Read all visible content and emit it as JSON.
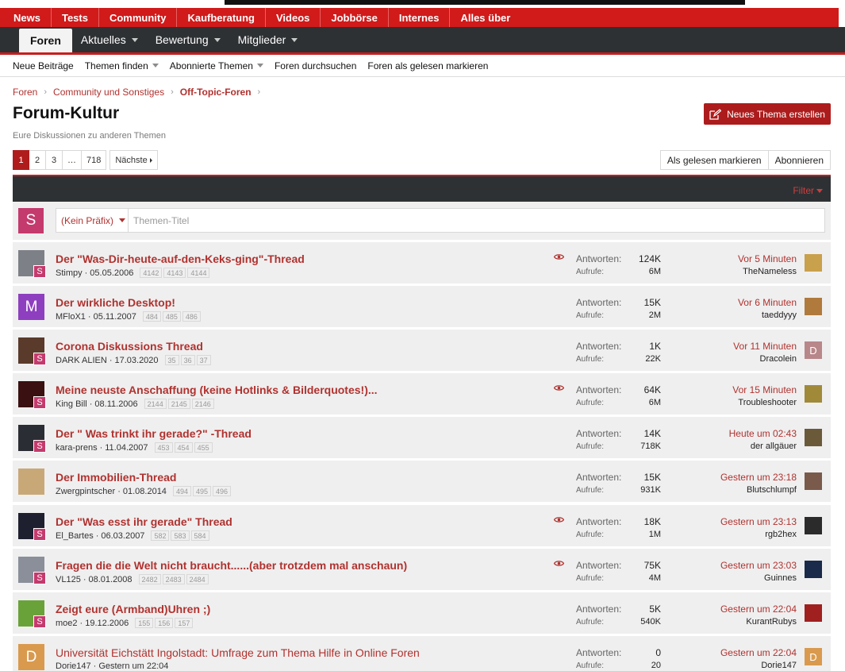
{
  "top_nav": [
    "News",
    "Tests",
    "Community",
    "Kaufberatung",
    "Videos",
    "Jobbörse",
    "Internes",
    "Alles über"
  ],
  "sub_nav": {
    "active": "Foren",
    "items": [
      "Aktuelles",
      "Bewertung",
      "Mitglieder"
    ]
  },
  "third_nav": [
    "Neue Beiträge",
    "Themen finden",
    "Abonnierte Themen",
    "Foren durchsuchen",
    "Foren als gelesen markieren"
  ],
  "breadcrumb": [
    "Foren",
    "Community und Sonstiges",
    "Off-Topic-Foren"
  ],
  "page": {
    "title": "Forum-Kultur",
    "description": "Eure Diskussionen zu anderen Themen",
    "new_thread": "Neues Thema erstellen"
  },
  "pagination": {
    "pages": [
      "1",
      "2",
      "3",
      "…",
      "718"
    ],
    "current": "1",
    "next": "Nächste"
  },
  "actions": {
    "mark_read": "Als gelesen markieren",
    "subscribe": "Abonnieren"
  },
  "filter": "Filter",
  "quick_thread": {
    "avatar_letter": "S",
    "prefix": "(Kein Präfix)",
    "placeholder": "Themen-Titel"
  },
  "stat_labels": {
    "replies": "Antworten:",
    "views": "Aufrufe:"
  },
  "colors": {
    "brand_red": "#d11a1a",
    "dark_bar": "#2e3134",
    "link_red": "#b0322f",
    "row_bg": "#efefef"
  },
  "threads": [
    {
      "title": "Der \"Was-Dir-heute-auf-den-Keks-ging\"-Thread",
      "author": "Stimpy",
      "date": "05.05.2006",
      "pages": [
        "4142",
        "4143",
        "4144"
      ],
      "watched": true,
      "replies": "124K",
      "views": "6M",
      "last_time": "Vor 5 Minuten",
      "last_user": "TheNameless",
      "avatar_letter": "",
      "avatar_color": "#7d8087",
      "badge": "S",
      "last_avatar_letter": "",
      "last_avatar_color": "#c9a04c"
    },
    {
      "title": "Der wirkliche Desktop!",
      "author": "MFloX1",
      "date": "05.11.2007",
      "pages": [
        "484",
        "485",
        "486"
      ],
      "watched": false,
      "replies": "15K",
      "views": "2M",
      "last_time": "Vor 6 Minuten",
      "last_user": "taeddyyy",
      "avatar_letter": "M",
      "avatar_color": "#8e3fbf",
      "badge": "",
      "last_avatar_letter": "",
      "last_avatar_color": "#b07a3c"
    },
    {
      "title": "Corona Diskussions Thread",
      "author": "DARK ALIEN",
      "date": "17.03.2020",
      "pages": [
        "35",
        "36",
        "37"
      ],
      "watched": false,
      "replies": "1K",
      "views": "22K",
      "last_time": "Vor 11 Minuten",
      "last_user": "Dracolein",
      "avatar_letter": "",
      "avatar_color": "#5a3a2a",
      "badge": "S",
      "last_avatar_letter": "D",
      "last_avatar_color": "#b8878a"
    },
    {
      "title": "Meine neuste Anschaffung (keine Hotlinks & Bilderquotes!)...",
      "author": "King Bill",
      "date": "08.11.2006",
      "pages": [
        "2144",
        "2145",
        "2146"
      ],
      "watched": true,
      "replies": "64K",
      "views": "6M",
      "last_time": "Vor 15 Minuten",
      "last_user": "Troubleshooter",
      "avatar_letter": "",
      "avatar_color": "#3a1010",
      "badge": "S",
      "last_avatar_letter": "",
      "last_avatar_color": "#a08a3a"
    },
    {
      "title": "Der \" Was trinkt ihr gerade?\" -Thread",
      "author": "kara-prens",
      "date": "11.04.2007",
      "pages": [
        "453",
        "454",
        "455"
      ],
      "watched": false,
      "replies": "14K",
      "views": "718K",
      "last_time": "Heute um 02:43",
      "last_user": "der allgäuer",
      "avatar_letter": "",
      "avatar_color": "#2a2d33",
      "badge": "S",
      "last_avatar_letter": "",
      "last_avatar_color": "#6b5a3a"
    },
    {
      "title": "Der Immobilien-Thread",
      "author": "Zwergpintscher",
      "date": "01.08.2014",
      "pages": [
        "494",
        "495",
        "496"
      ],
      "watched": false,
      "replies": "15K",
      "views": "931K",
      "last_time": "Gestern um 23:18",
      "last_user": "Blutschlumpf",
      "avatar_letter": "",
      "avatar_color": "#c9a878",
      "badge": "",
      "last_avatar_letter": "",
      "last_avatar_color": "#7a5a4a"
    },
    {
      "title": "Der \"Was esst ihr gerade\" Thread",
      "author": "El_Bartes",
      "date": "06.03.2007",
      "pages": [
        "582",
        "583",
        "584"
      ],
      "watched": true,
      "replies": "18K",
      "views": "1M",
      "last_time": "Gestern um 23:13",
      "last_user": "rgb2hex",
      "avatar_letter": "",
      "avatar_color": "#1e2030",
      "badge": "S",
      "last_avatar_letter": "",
      "last_avatar_color": "#2b2b2b"
    },
    {
      "title": "Fragen die die Welt nicht braucht......(aber trotzdem mal anschaun)",
      "author": "VL125",
      "date": "08.01.2008",
      "pages": [
        "2482",
        "2483",
        "2484"
      ],
      "watched": true,
      "replies": "75K",
      "views": "4M",
      "last_time": "Gestern um 23:03",
      "last_user": "Guinnes",
      "avatar_letter": "",
      "avatar_color": "#8a8f9a",
      "badge": "S",
      "last_avatar_letter": "",
      "last_avatar_color": "#1a2a4a"
    },
    {
      "title": "Zeigt eure (Armband)Uhren ;)",
      "author": "moe2",
      "date": "19.12.2006",
      "pages": [
        "155",
        "156",
        "157"
      ],
      "watched": false,
      "replies": "5K",
      "views": "540K",
      "last_time": "Gestern um 22:04",
      "last_user": "KurantRubys",
      "avatar_letter": "",
      "avatar_color": "#6aa23a",
      "badge": "S",
      "last_avatar_letter": "",
      "last_avatar_color": "#a02020"
    },
    {
      "title": "Universität Eichstätt Ingolstadt: Umfrage zum Thema Hilfe in Online Foren",
      "author": "Dorie147",
      "date": "Gestern um 22:04",
      "pages": [],
      "watched": false,
      "replies": "0",
      "views": "20",
      "last_time": "Gestern um 22:04",
      "last_user": "Dorie147",
      "avatar_letter": "D",
      "avatar_color": "#d99a4e",
      "badge": "",
      "last_avatar_letter": "D",
      "last_avatar_color": "#d99a4e",
      "unread": false
    }
  ]
}
